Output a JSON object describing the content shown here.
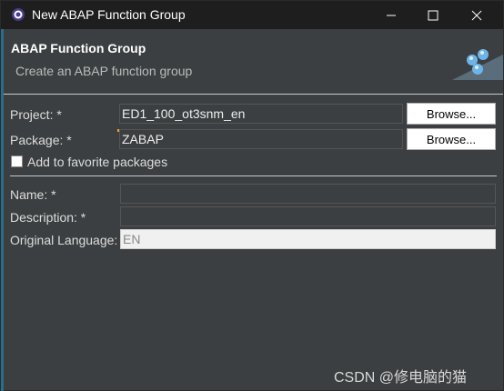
{
  "window": {
    "title": "New ABAP Function Group",
    "minimize_icon": "minimize-icon",
    "maximize_icon": "maximize-icon",
    "close_icon": "close-icon"
  },
  "header": {
    "title": "ABAP Function Group",
    "subtitle": "Create an ABAP function group"
  },
  "form": {
    "project": {
      "label": "Project: *",
      "value": "ED1_100_ot3snm_en",
      "browse_label": "Browse..."
    },
    "package": {
      "label": "Package: *",
      "value": "ZABAP",
      "browse_label": "Browse..."
    },
    "favorite": {
      "label": "Add to favorite packages",
      "checked": false
    },
    "name": {
      "label": "Name: *",
      "value": ""
    },
    "description": {
      "label": "Description: *",
      "value": ""
    },
    "original_language": {
      "label": "Original Language:",
      "value": "EN"
    }
  },
  "watermark": "CSDN @修电脑的猫",
  "colors": {
    "titlebar": "#1e1e1e",
    "dialog_bg": "#3c3f41",
    "accent_strip": "#2a6e8a"
  }
}
